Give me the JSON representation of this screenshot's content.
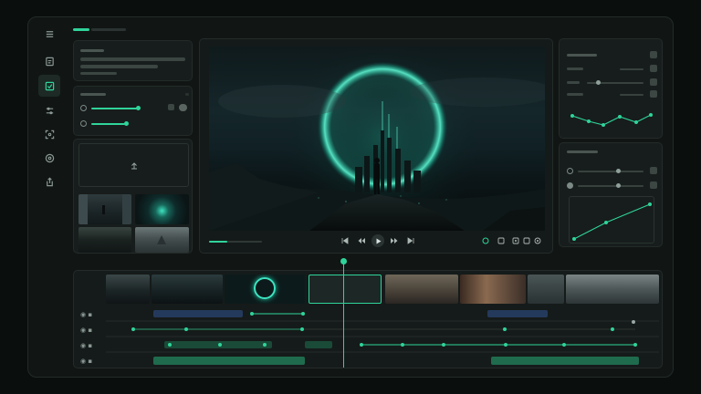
{
  "app": {
    "accent": "#2fd49a",
    "background": "#111615",
    "panel": "#171d1c"
  },
  "rail": {
    "items": [
      {
        "name": "menu-icon",
        "active": false
      },
      {
        "name": "document-icon",
        "active": false
      },
      {
        "name": "image-check-icon",
        "active": true
      },
      {
        "name": "sliders-icon",
        "active": false
      },
      {
        "name": "focus-icon",
        "active": false
      },
      {
        "name": "target-icon",
        "active": false
      },
      {
        "name": "export-icon",
        "active": false
      }
    ]
  },
  "viewer": {
    "playhead_progress": 0.35,
    "controls": [
      "skip-back-icon",
      "step-back-icon",
      "play-icon",
      "step-forward-icon",
      "skip-forward-icon"
    ],
    "tools": [
      "loop-icon",
      "marker-icon",
      "crop-icon",
      "fullscreen-icon",
      "settings-icon"
    ]
  },
  "timeline": {
    "rows": 4
  }
}
